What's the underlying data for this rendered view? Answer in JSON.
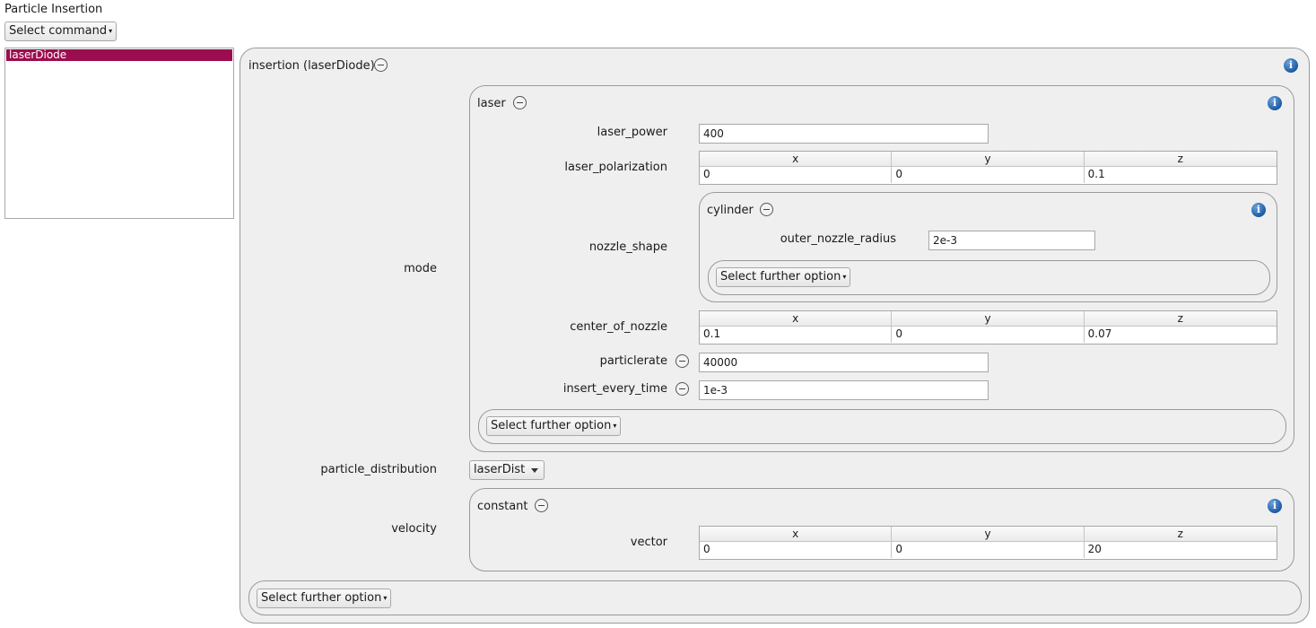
{
  "header": {
    "title": "Particle Insertion",
    "select_command": "Select command"
  },
  "command_list": {
    "items": [
      {
        "label": "laserDiode",
        "selected": true
      }
    ]
  },
  "insertion": {
    "title": "insertion (laserDiode)",
    "mode_label": "mode",
    "laser": {
      "title": "laser",
      "laser_power": {
        "label": "laser_power",
        "value": "400"
      },
      "laser_polarization": {
        "label": "laser_polarization",
        "headers": [
          "x",
          "y",
          "z"
        ],
        "values": [
          "0",
          "0",
          "0.1"
        ]
      },
      "nozzle_shape": {
        "label": "nozzle_shape",
        "cylinder": {
          "title": "cylinder",
          "outer_nozzle_radius": {
            "label": "outer_nozzle_radius",
            "value": "2e-3"
          },
          "further_option": "Select further option"
        }
      },
      "center_of_nozzle": {
        "label": "center_of_nozzle",
        "headers": [
          "x",
          "y",
          "z"
        ],
        "values": [
          "0.1",
          "0",
          "0.07"
        ]
      },
      "particlerate": {
        "label": "particlerate",
        "value": "40000"
      },
      "insert_every_time": {
        "label": "insert_every_time",
        "value": "1e-3"
      },
      "further_option": "Select further option"
    },
    "particle_distribution": {
      "label": "particle_distribution",
      "value": "laserDist"
    },
    "velocity": {
      "label": "velocity",
      "constant": {
        "title": "constant",
        "vector": {
          "label": "vector",
          "headers": [
            "x",
            "y",
            "z"
          ],
          "values": [
            "0",
            "0",
            "20"
          ]
        }
      }
    },
    "further_option": "Select further option"
  },
  "colors": {
    "selection": "#9b0d4e",
    "group_bg": "#efefef",
    "info_icon": "#1d5aa3"
  }
}
